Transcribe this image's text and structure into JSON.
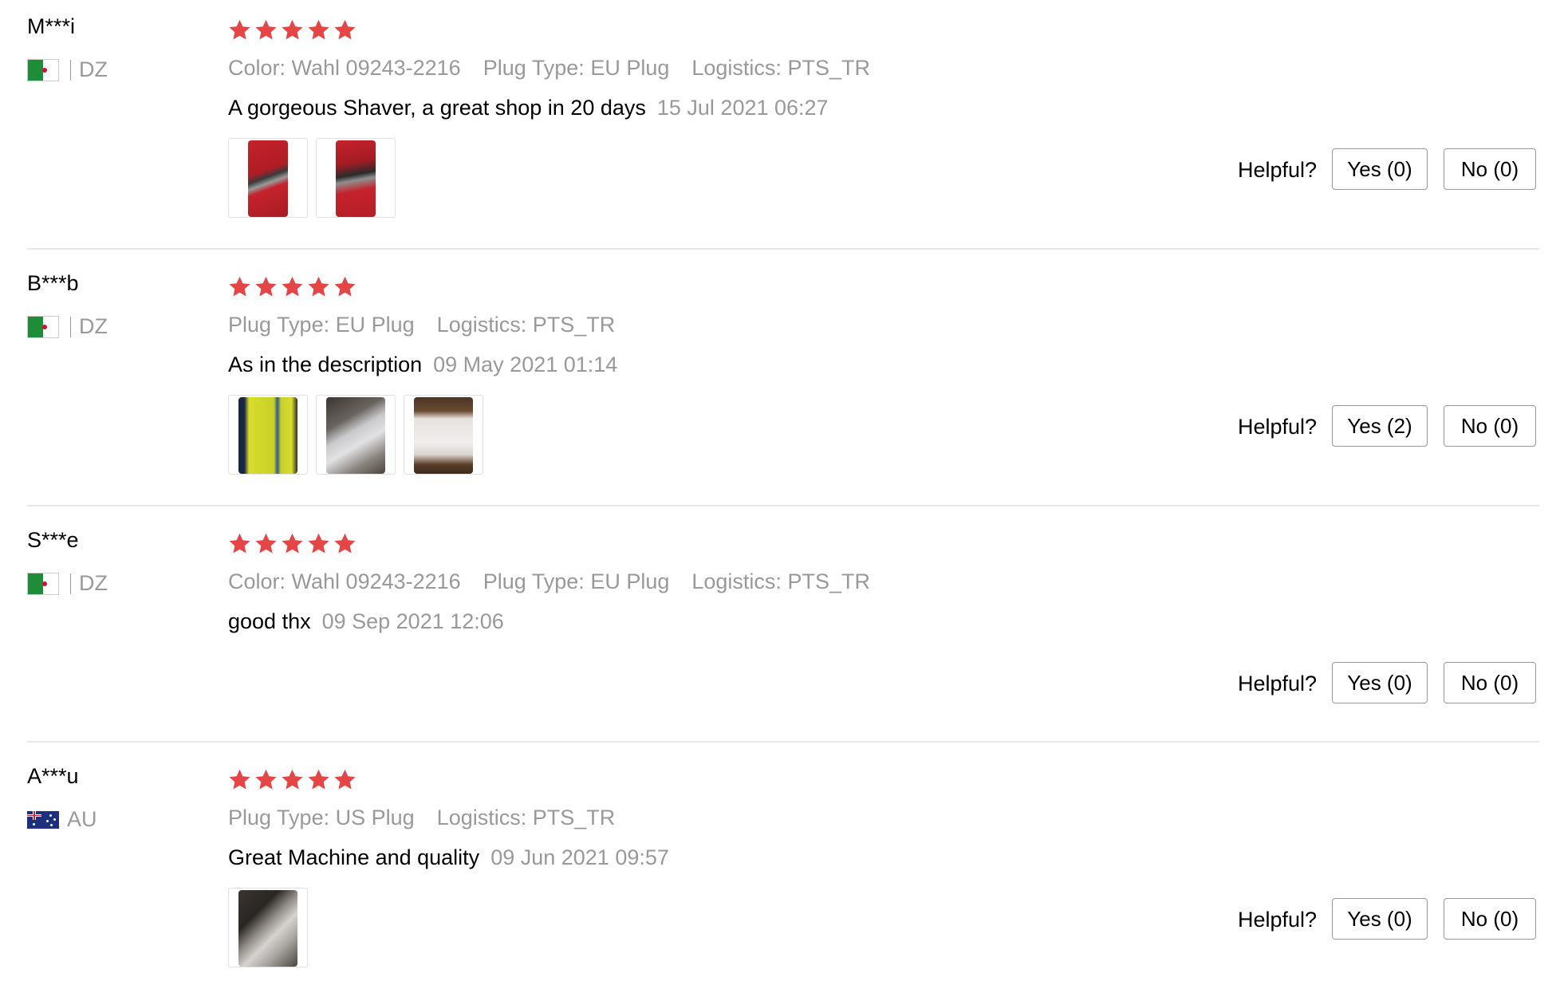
{
  "colors": {
    "star": "#e64545",
    "muted": "#999999",
    "divider": "#e8e8e8"
  },
  "labels": {
    "helpful": "Helpful?",
    "color_key": "Color:",
    "plug_key": "Plug Type:",
    "logistics_key": "Logistics:"
  },
  "reviews": [
    {
      "user": "M***i",
      "country": "DZ",
      "flag": "algeria-flag-icon",
      "rating": 5,
      "color": "Wahl 09243-2216",
      "plug_type": "EU Plug",
      "logistics": "PTS_TR",
      "comment": "A gorgeous Shaver, a great shop in 20 days",
      "date": "15 Jul 2021 06:27",
      "photos": 2,
      "yes": "Yes (0)",
      "no": "No (0)"
    },
    {
      "user": "B***b",
      "country": "DZ",
      "flag": "algeria-flag-icon",
      "rating": 5,
      "plug_type": "EU Plug",
      "logistics": "PTS_TR",
      "comment": "As in the description",
      "date": "09 May 2021 01:14",
      "photos": 3,
      "yes": "Yes (2)",
      "no": "No (0)"
    },
    {
      "user": "S***e",
      "country": "DZ",
      "flag": "algeria-flag-icon",
      "rating": 5,
      "color": "Wahl 09243-2216",
      "plug_type": "EU Plug",
      "logistics": "PTS_TR",
      "comment": "good thx",
      "date": "09 Sep 2021 12:06",
      "photos": 0,
      "yes": "Yes (0)",
      "no": "No (0)"
    },
    {
      "user": "A***u",
      "country": "AU",
      "flag": "australia-flag-icon",
      "rating": 5,
      "plug_type": "US Plug",
      "logistics": "PTS_TR",
      "comment": "Great Machine and quality",
      "date": "09 Jun 2021 09:57",
      "photos": 1,
      "yes": "Yes (0)",
      "no": "No (0)"
    }
  ]
}
